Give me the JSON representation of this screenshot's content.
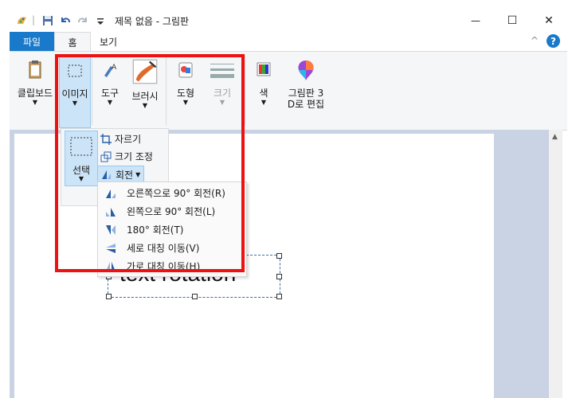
{
  "window": {
    "title": "제목 없음 - 그림판",
    "minimize": "—",
    "maximize": "☐",
    "close": "✕"
  },
  "tabs": {
    "file": "파일",
    "home": "홈",
    "view": "보기"
  },
  "ribbon": {
    "clipboard": "클립보드",
    "image": "이미지",
    "tools": "도구",
    "brushes": "브러시",
    "shapes": "도형",
    "size": "크기",
    "color": "색",
    "paint3d_line1": "그림판 3",
    "paint3d_line2": "D로 편집"
  },
  "image_panel": {
    "select": "선택",
    "crop": "자르기",
    "resize": "크기 조정",
    "rotate": "회전"
  },
  "rotate_menu": [
    {
      "label": "오른쪽으로 90° 회전(R)",
      "icon": "rotate-right-icon"
    },
    {
      "label": "왼쪽으로 90° 회전(L)",
      "icon": "rotate-left-icon"
    },
    {
      "label": "180° 회전(T)",
      "icon": "rotate-180-icon"
    },
    {
      "label": "세로 대칭 이동(V)",
      "icon": "flip-vertical-icon"
    },
    {
      "label": "가로 대칭 이동(H)",
      "icon": "flip-horizontal-icon"
    }
  ],
  "canvas": {
    "text": "text rotation"
  },
  "colors": {
    "file_tab": "#1979ca",
    "highlight": "#e11",
    "selected_group": "#cce4f7"
  }
}
